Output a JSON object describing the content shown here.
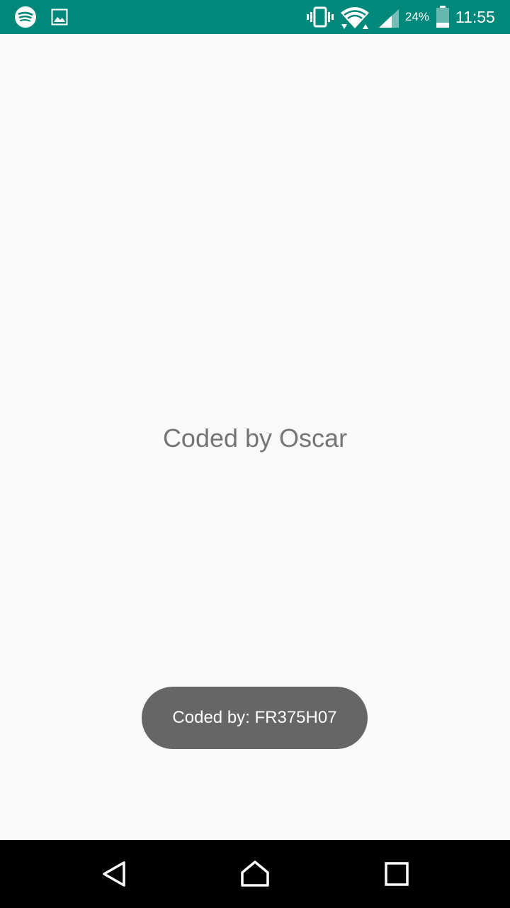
{
  "status_bar": {
    "background": "#00897b",
    "notification_icons": [
      "spotify-icon",
      "image-icon"
    ],
    "system_icons": [
      "vibrate-icon",
      "wifi-icon",
      "signal-icon",
      "battery-icon"
    ],
    "battery_percent": "24%",
    "time": "11:55"
  },
  "main": {
    "title": "Coded by Oscar",
    "title_color": "#757575"
  },
  "toast": {
    "text": "Coded by: FR375H07",
    "background": "#666666"
  },
  "nav_bar": {
    "buttons": [
      "back-icon",
      "home-icon",
      "recents-icon"
    ]
  }
}
